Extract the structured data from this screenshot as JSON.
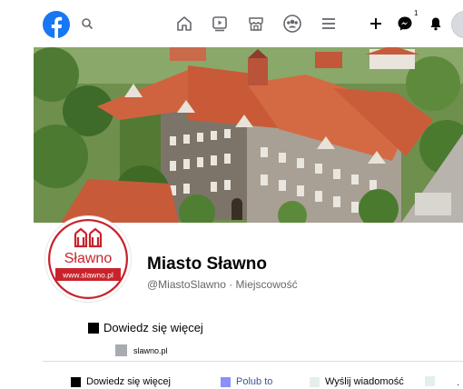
{
  "colors": {
    "brand": "#1877f2",
    "like_square": "#8b8ff7",
    "message_square": "#e4efe9",
    "profile_red": "#c8232c"
  },
  "nav": {
    "icons": [
      "facebook-logo",
      "search-icon",
      "home-icon",
      "watch-icon",
      "marketplace-icon",
      "groups-icon",
      "menu-icon",
      "plus-icon",
      "messenger-icon",
      "notifications-icon"
    ],
    "messenger_badge": "1"
  },
  "profile": {
    "logo_text": "Sławno",
    "logo_url": "www.slawno.pl",
    "name": "Miasto Sławno",
    "subtitle": "@MiastoSlawno · Miejscowość"
  },
  "about": {
    "learn_more": "Dowiedz się więcej",
    "website": "slawno.pl"
  },
  "actions": {
    "learn_more": "Dowiedz się więcej",
    "like": "Polub to",
    "message": "Wyślij wiadomość",
    "more": "·"
  }
}
